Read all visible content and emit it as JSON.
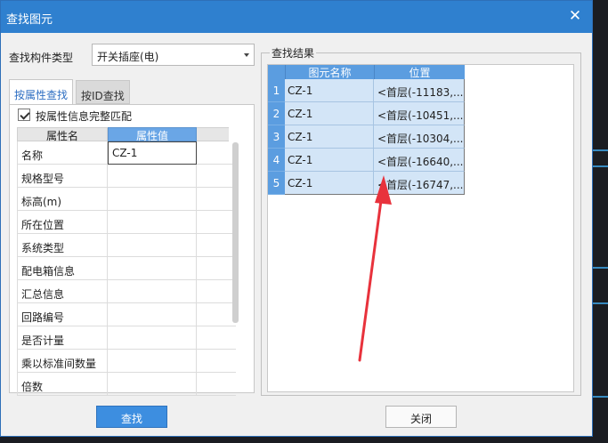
{
  "window": {
    "title": "查找图元",
    "close_glyph": "✕"
  },
  "component_type": {
    "label": "查找构件类型",
    "value": "开关插座(电)"
  },
  "tabs": [
    {
      "label": "按属性查找",
      "active": true
    },
    {
      "label": "按ID查找",
      "active": false
    }
  ],
  "match_full": {
    "label": "按属性信息完整匹配",
    "checked": true
  },
  "property_table": {
    "headers": [
      "属性名",
      "属性值"
    ],
    "rows": [
      {
        "name": "名称",
        "value": "CZ-1"
      },
      {
        "name": "规格型号",
        "value": ""
      },
      {
        "name": "标高(m)",
        "value": ""
      },
      {
        "name": "所在位置",
        "value": ""
      },
      {
        "name": "系统类型",
        "value": ""
      },
      {
        "name": "配电箱信息",
        "value": ""
      },
      {
        "name": "汇总信息",
        "value": ""
      },
      {
        "name": "回路编号",
        "value": ""
      },
      {
        "name": "是否计量",
        "value": ""
      },
      {
        "name": "乘以标准间数量",
        "value": ""
      },
      {
        "name": "倍数",
        "value": ""
      }
    ]
  },
  "results": {
    "group_title": "查找结果",
    "headers": [
      "图元名称",
      "位置"
    ],
    "rows": [
      {
        "index": "1",
        "name": "CZ-1",
        "position": "<首层(-11183,..."
      },
      {
        "index": "2",
        "name": "CZ-1",
        "position": "<首层(-10451,..."
      },
      {
        "index": "3",
        "name": "CZ-1",
        "position": "<首层(-10304,..."
      },
      {
        "index": "4",
        "name": "CZ-1",
        "position": "<首层(-16640,..."
      },
      {
        "index": "5",
        "name": "CZ-1",
        "position": "<首层(-16747,..."
      }
    ]
  },
  "buttons": {
    "find": "查找",
    "close": "关闭"
  },
  "colors": {
    "titlebar": "#2f80cf",
    "accent": "#3d8ee0",
    "annotation_arrow": "#e8323c"
  }
}
